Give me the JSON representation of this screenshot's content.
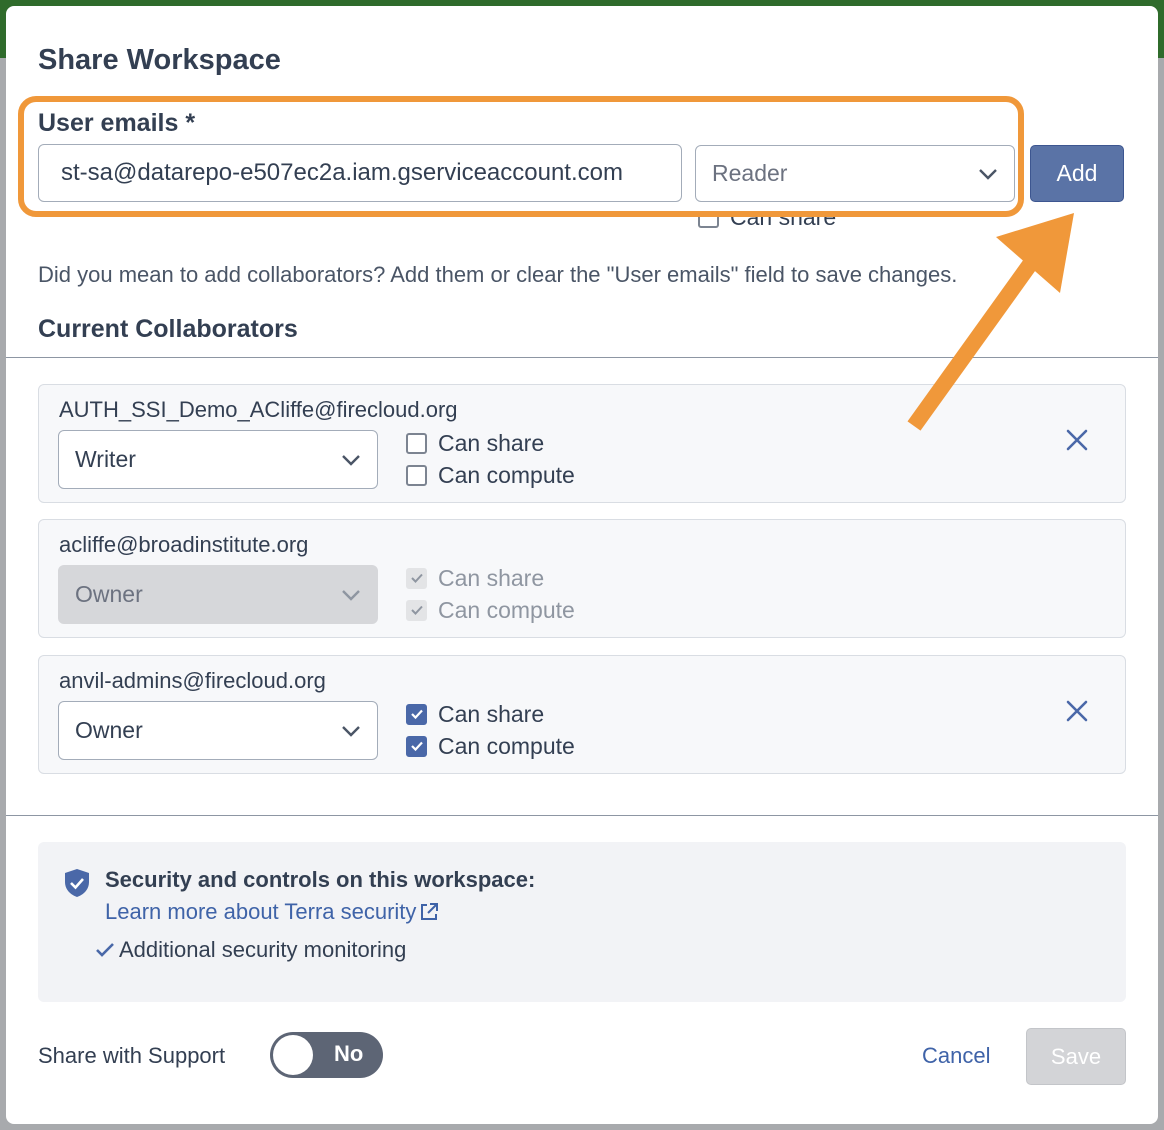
{
  "dialog": {
    "title": "Share Workspace",
    "user_emails_label": "User emails *",
    "email_value": "st-sa@datarepo-e507ec2a.iam.gserviceaccount.com",
    "role_select_value": "Reader",
    "add_label": "Add",
    "hidden_can_share": "Can share",
    "hint": "Did you mean to add collaborators? Add them or clear the \"User emails\" field to save changes.",
    "current_collaborators_label": "Current Collaborators"
  },
  "collaborators": [
    {
      "email": "AUTH_SSI_Demo_ACliffe@firecloud.org",
      "role": "Writer",
      "can_share": "Can share",
      "can_compute": "Can compute"
    },
    {
      "email": "acliffe@broadinstitute.org",
      "role": "Owner",
      "can_share": "Can share",
      "can_compute": "Can compute"
    },
    {
      "email": "anvil-admins@firecloud.org",
      "role": "Owner",
      "can_share": "Can share",
      "can_compute": "Can compute"
    }
  ],
  "security": {
    "title": "Security and controls on this workspace:",
    "link": "Learn more about Terra security",
    "item": "Additional security monitoring"
  },
  "footer": {
    "share_support_label": "Share with Support",
    "toggle_value": "No",
    "cancel_label": "Cancel",
    "save_label": "Save"
  },
  "colors": {
    "accent": "#5a73a6",
    "highlight": "#f0983a",
    "link": "#3f63a8",
    "topbar": "#2f6b2b"
  },
  "icons": [
    "chevron-down-icon",
    "check-icon",
    "close-icon",
    "shield-check-icon",
    "external-link-icon",
    "arrow-annotation"
  ]
}
